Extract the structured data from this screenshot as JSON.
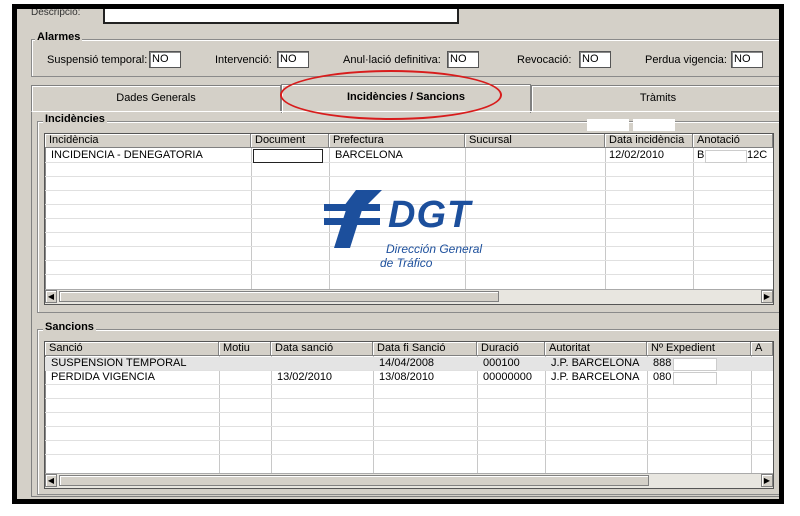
{
  "description": {
    "label": "Descripció:"
  },
  "alarms": {
    "title": "Alarmes",
    "items": [
      {
        "label": "Suspensió temporal:",
        "value": "NO"
      },
      {
        "label": "Intervenció:",
        "value": "NO"
      },
      {
        "label": "Anul·lació definitiva:",
        "value": "NO"
      },
      {
        "label": "Revocació:",
        "value": "NO"
      },
      {
        "label": "Perdua vigencia:",
        "value": "NO"
      }
    ]
  },
  "tabs": [
    {
      "label": "Dades Generals",
      "active": false
    },
    {
      "label": "Incidències / Sancions",
      "active": true
    },
    {
      "label": "Tràmits",
      "active": false
    }
  ],
  "incidencies": {
    "title": "Incidències",
    "columns": [
      "Incidència",
      "Document",
      "Prefectura",
      "Sucursal",
      "Data incidència",
      "Anotació"
    ],
    "rows": [
      [
        "INCIDENCIA - DENEGATORIA",
        "",
        "BARCELONA",
        "",
        "12/02/2010",
        "B",
        "12C"
      ]
    ]
  },
  "sancions": {
    "title": "Sancions",
    "columns": [
      "Sanció",
      "Motiu",
      "Data sanció",
      "Data fi Sanció",
      "Duració",
      "Autoritat",
      "Nº Expedient",
      "A"
    ],
    "rows": [
      [
        "SUSPENSION TEMPORAL",
        "",
        "",
        "14/04/2008",
        "000100",
        "J.P. BARCELONA",
        "888"
      ],
      [
        "PERDIDA VIGENCIA",
        "",
        "13/02/2010",
        "13/08/2010",
        "00000000",
        "J.P. BARCELONA",
        "080"
      ]
    ]
  },
  "logo": {
    "abbr": "DGT",
    "line1": "Dirección General",
    "line2": "de Tráfico",
    "color": "#1c4f9c"
  },
  "highlight_color": "#d81c1c"
}
